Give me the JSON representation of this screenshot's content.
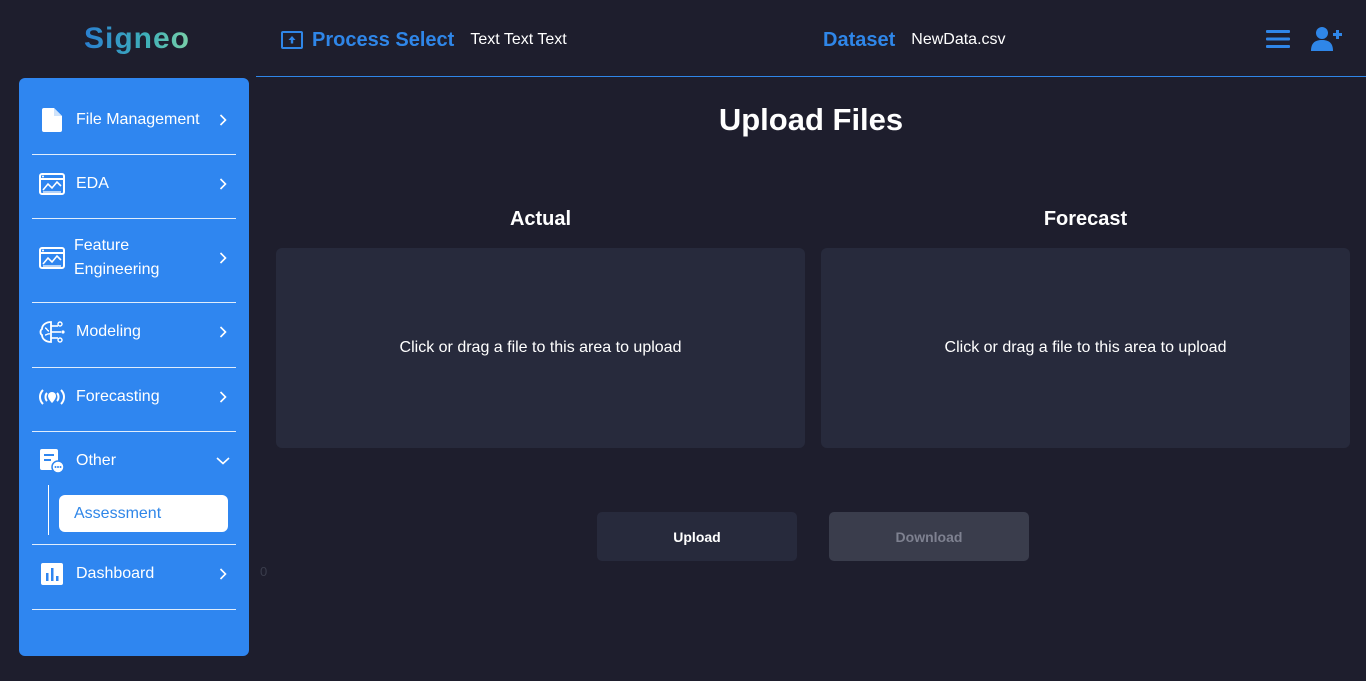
{
  "header": {
    "logo_text": "Signeo",
    "process_title": "Process Select",
    "process_text": "Text Text Text",
    "dataset_title": "Dataset",
    "dataset_file": "NewData.csv",
    "icons": [
      "upload-box-icon",
      "hamburger-menu-icon",
      "user-add-icon"
    ]
  },
  "sidebar": {
    "items": [
      {
        "label": "File Management",
        "icon": "file-icon"
      },
      {
        "label": "EDA",
        "icon": "chart-window-icon"
      },
      {
        "label": "Feature Engineering",
        "icon": "chart-window-icon"
      },
      {
        "label": "Modeling",
        "icon": "brain-circuit-icon"
      },
      {
        "label": "Forecasting",
        "icon": "broadcast-icon"
      },
      {
        "label": "Other",
        "icon": "document-chat-icon",
        "expanded": true
      },
      {
        "label": "Dashboard",
        "icon": "bar-chart-icon"
      }
    ],
    "sub_items": [
      {
        "label": "Assessment",
        "active": true
      }
    ]
  },
  "main": {
    "title": "Upload Files",
    "actual": {
      "title": "Actual",
      "dropzone_text": "Click or drag a file to this area to upload"
    },
    "forecast": {
      "title": "Forecast",
      "dropzone_text": "Click or drag a file to this area to upload"
    },
    "upload_label": "Upload",
    "download_label": "Download",
    "stray_text": "0"
  },
  "colors": {
    "background": "#1e1e2d",
    "accent": "#2f86e8",
    "sidebar": "#2f86f0",
    "panel": "#272a3c"
  }
}
